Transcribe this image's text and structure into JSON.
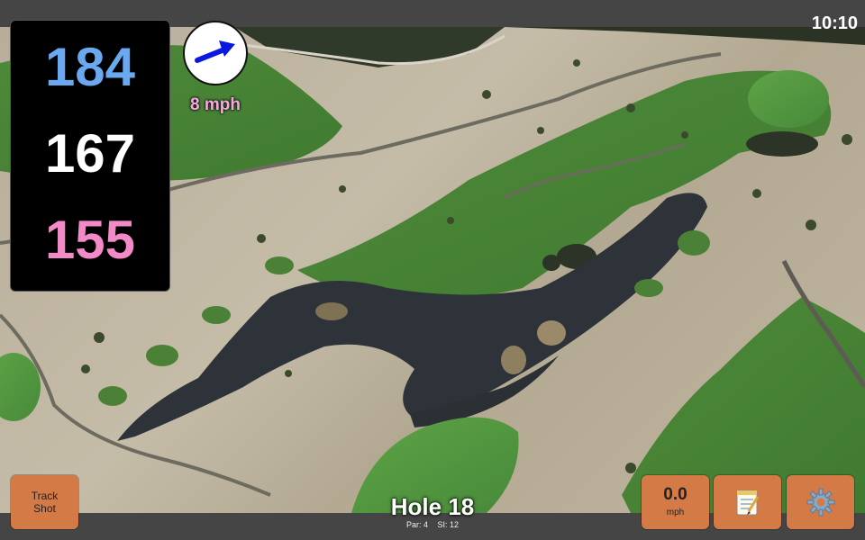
{
  "status": {
    "time": "10:10"
  },
  "distances": {
    "back": "184",
    "middle": "167",
    "front": "155"
  },
  "wind": {
    "speed_label": "8 mph",
    "arrow_icon": "wind-direction-arrow-icon",
    "arrow_color": "#0a18e0"
  },
  "hole": {
    "title": "Hole 18",
    "par": "Par: 4",
    "si": "SI: 12"
  },
  "buttons": {
    "track_shot": "Track\nShot",
    "speed_value": "0.0",
    "speed_unit": "mph",
    "notes_icon": "notepad-icon",
    "settings_icon": "gear-icon"
  },
  "colors": {
    "back_distance": "#6aa8f0",
    "middle_distance": "#ffffff",
    "front_distance": "#f28ac8",
    "button_bg": "#d47a46",
    "wind_label": "#f7a8e0"
  }
}
